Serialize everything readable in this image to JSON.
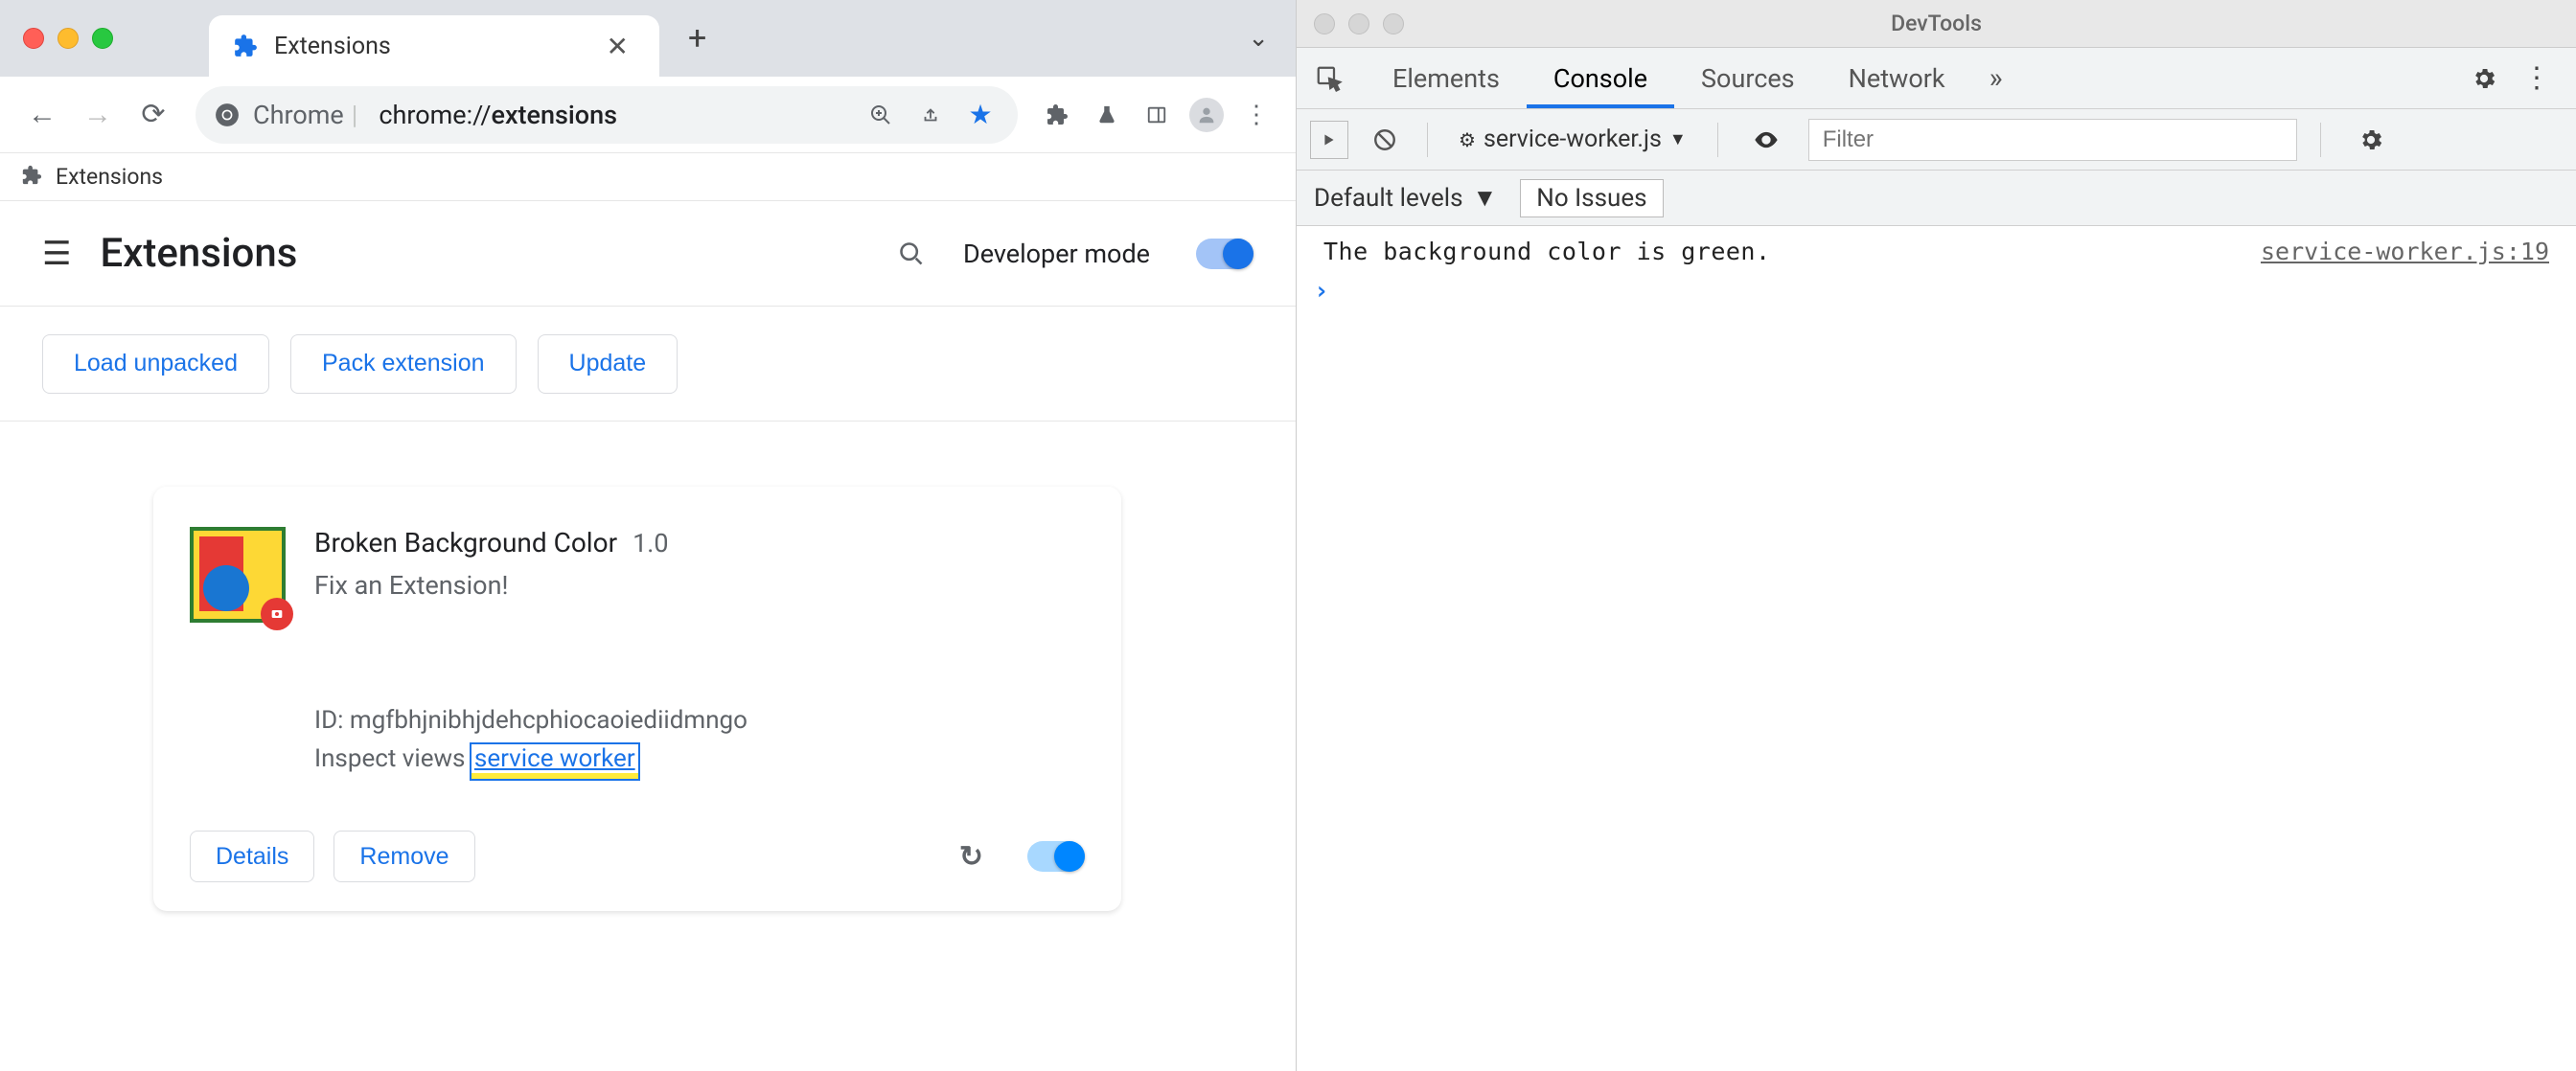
{
  "chrome": {
    "tab": {
      "title": "Extensions"
    },
    "omnibox": {
      "scheme_label": "Chrome",
      "url_prefix": "chrome://",
      "url_path": "extensions"
    },
    "bookmark": {
      "label": "Extensions"
    }
  },
  "ext_page": {
    "title": "Extensions",
    "dev_mode_label": "Developer mode",
    "actions": {
      "load_unpacked": "Load unpacked",
      "pack_extension": "Pack extension",
      "update": "Update"
    },
    "card": {
      "name": "Broken Background Color",
      "version": "1.0",
      "description": "Fix an Extension!",
      "id_label": "ID:",
      "id_value": "mgfbhjnibhjdehcphiocaoiediidmngo",
      "inspect_label": "Inspect views",
      "service_worker_link": "service worker",
      "details": "Details",
      "remove": "Remove"
    }
  },
  "devtools": {
    "title": "DevTools",
    "tabs": {
      "elements": "Elements",
      "console": "Console",
      "sources": "Sources",
      "network": "Network"
    },
    "toolbar": {
      "context": "service-worker.js",
      "filter_placeholder": "Filter"
    },
    "toolbar2": {
      "levels": "Default levels",
      "issues": "No Issues"
    },
    "log": {
      "message": "The background color is green.",
      "source": "service-worker.js:19"
    }
  }
}
